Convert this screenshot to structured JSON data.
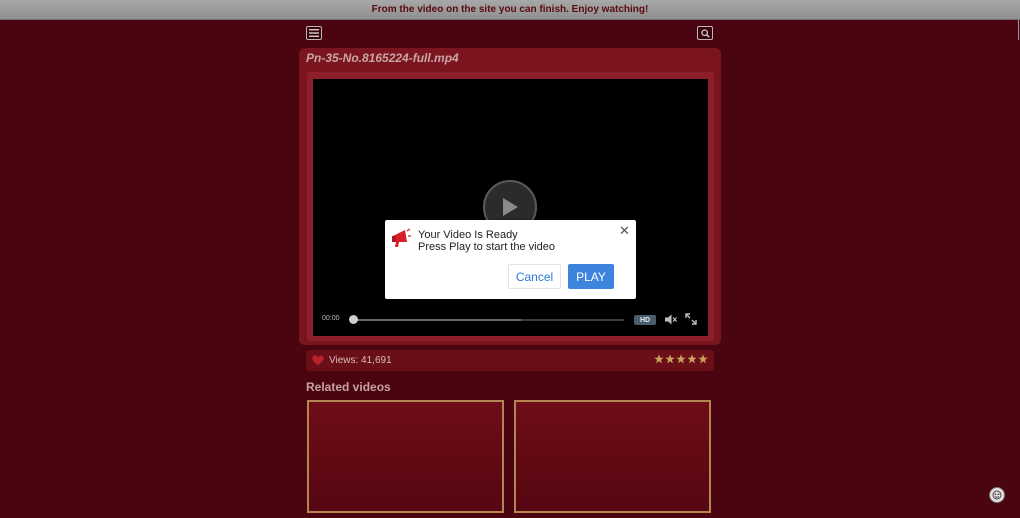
{
  "banner": {
    "text": "From the video on the site you can finish. Enjoy watching!"
  },
  "header": {
    "menu_icon": "hamburger-icon",
    "search_icon": "search-icon"
  },
  "video": {
    "title": "Pn-35-No.8165224-full.mp4",
    "current_time": "00:00",
    "progress": 0.0,
    "buffered": 0.62,
    "quality_badge": "HD"
  },
  "modal": {
    "icon": "megaphone-icon",
    "title": "Your Video Is Ready",
    "message": "Press Play to start the video",
    "cancel_label": "Cancel",
    "play_label": "PLAY"
  },
  "stats": {
    "views": "Views: 41,691",
    "rating": 5,
    "rating_max": 5
  },
  "related": {
    "title": "Related videos",
    "items": [
      {},
      {}
    ]
  },
  "colors": {
    "background": "#4a0510",
    "panel": "#7a1520",
    "accent_button": "#3d84de",
    "thumb_border": "#b3864f",
    "star": "#c9a25a"
  }
}
